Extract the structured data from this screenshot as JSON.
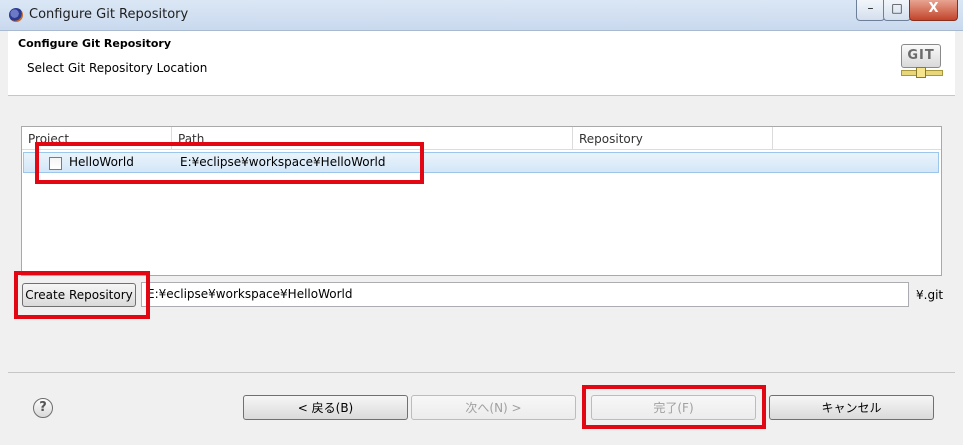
{
  "window": {
    "title": "Configure Git Repository",
    "minimize": "–",
    "maximize": "□",
    "close": "X"
  },
  "header": {
    "title": "Configure Git Repository",
    "subtitle": "Select Git Repository Location",
    "logo_text": "GIT"
  },
  "table": {
    "columns": [
      "Project",
      "Path",
      "Repository",
      ""
    ],
    "rows": [
      {
        "project": "HelloWorld",
        "path": "E:¥eclipse¥workspace¥HelloWorld",
        "repository": "",
        "checked": false
      }
    ]
  },
  "repository": {
    "create_button": "Create Repository",
    "path_value": "E:¥eclipse¥workspace¥HelloWorld",
    "suffix": "¥.git"
  },
  "footer": {
    "help_icon": "?",
    "back_button": "< 戻る(B)",
    "next_button": "次へ(N) >",
    "finish_button": "完了(F)",
    "cancel_button": "キャンセル"
  },
  "colors": {
    "highlight_box": "#e30613",
    "row_selection": "#d3e7f8"
  }
}
